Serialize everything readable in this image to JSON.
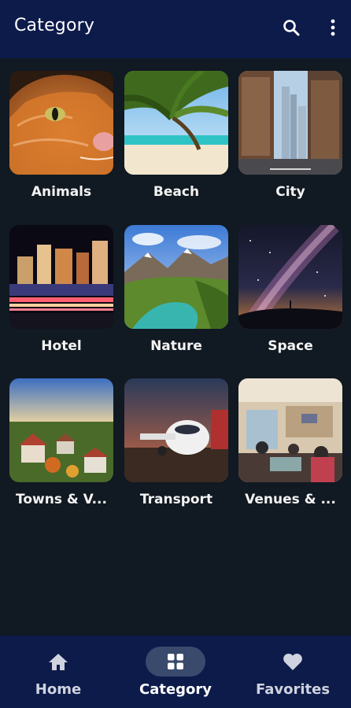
{
  "header": {
    "title": "Category",
    "search_icon": "search-icon",
    "more_icon": "more-vert-icon"
  },
  "categories": [
    {
      "label": "Animals"
    },
    {
      "label": "Beach"
    },
    {
      "label": "City"
    },
    {
      "label": "Hotel"
    },
    {
      "label": "Nature"
    },
    {
      "label": "Space"
    },
    {
      "label": "Towns & V..."
    },
    {
      "label": "Transport"
    },
    {
      "label": "Venues & ..."
    }
  ],
  "bottom_nav": {
    "items": [
      {
        "label": "Home",
        "icon": "home-icon",
        "active": false
      },
      {
        "label": "Category",
        "icon": "grid-icon",
        "active": true
      },
      {
        "label": "Favorites",
        "icon": "heart-icon",
        "active": false
      }
    ]
  },
  "colors": {
    "appbar": "#0d1b4b",
    "background": "#111922",
    "nav_pill_active": "#3a4a6c"
  }
}
